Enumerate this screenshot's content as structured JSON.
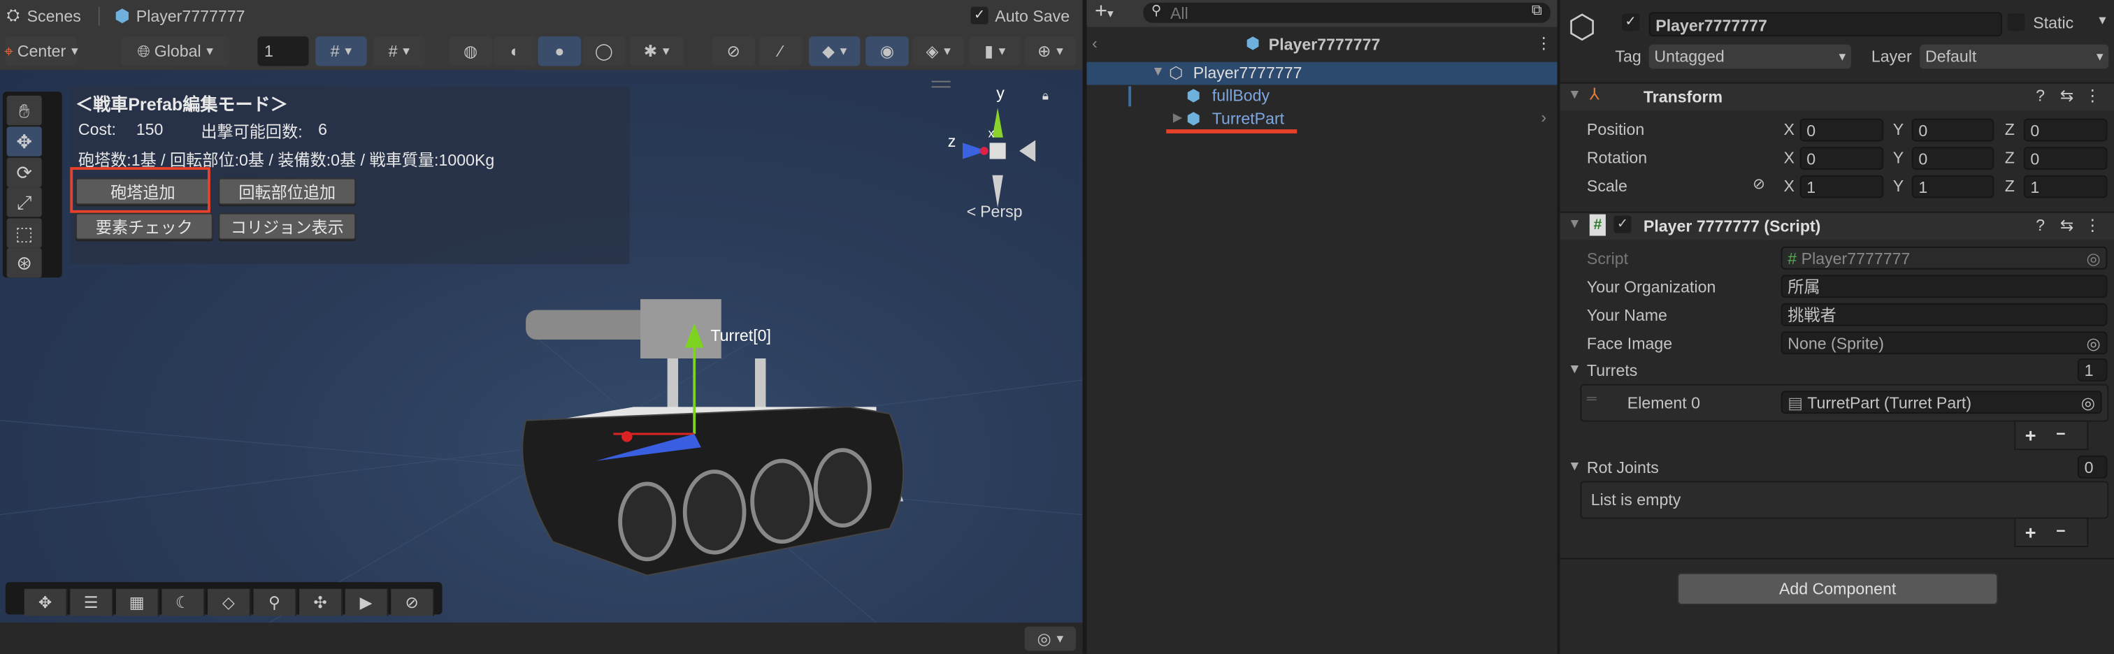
{
  "scene": {
    "breadcrumb": {
      "root": "Scenes",
      "prefab": "Player7777777"
    },
    "auto_save_label": "Auto Save",
    "auto_save_checked": true,
    "toolbar": {
      "pivot": "Center",
      "space": "Global",
      "grid_value": "1"
    },
    "overlay": {
      "title": "＜戦車Prefab編集モード＞",
      "cost_label": "Cost:",
      "cost_value": "150",
      "sortie_label": "出撃可能回数:",
      "sortie_value": "6",
      "stats": "砲塔数:1基 / 回転部位:0基 / 装備数:0基 / 戦車質量:1000Kg",
      "buttons": [
        "砲塔追加",
        "回転部位追加",
        "要素チェック",
        "コリジョン表示"
      ]
    },
    "gizmo": {
      "y": "y",
      "z": "z",
      "x": "x",
      "persp": "Persp"
    },
    "turret_label": "Turret[0]"
  },
  "hierarchy": {
    "search_placeholder": "All",
    "header_title": "Player7777777",
    "items": [
      {
        "label": "Player7777777",
        "depth": 0,
        "selected": true
      },
      {
        "label": "fullBody",
        "depth": 1
      },
      {
        "label": "TurretPart",
        "depth": 1
      }
    ]
  },
  "inspector": {
    "object_name": "Player7777777",
    "active": true,
    "static_label": "Static",
    "tag_label": "Tag",
    "tag_value": "Untagged",
    "layer_label": "Layer",
    "layer_value": "Default",
    "transform": {
      "title": "Transform",
      "rows": [
        {
          "label": "Position",
          "x": "0",
          "y": "0",
          "z": "0"
        },
        {
          "label": "Rotation",
          "x": "0",
          "y": "0",
          "z": "0"
        },
        {
          "label": "Scale",
          "x": "1",
          "y": "1",
          "z": "1"
        }
      ],
      "axes": [
        "X",
        "Y",
        "Z"
      ]
    },
    "script": {
      "title": "Player 7777777 (Script)",
      "script_label": "Script",
      "script_value": "Player7777777",
      "org_label": "Your Organization",
      "org_value": "所属",
      "name_label": "Your Name",
      "name_value": "挑戦者",
      "face_label": "Face Image",
      "face_value": "None (Sprite)",
      "turrets_label": "Turrets",
      "turrets_count": "1",
      "element_label": "Element 0",
      "element_value": "TurretPart (Turret Part)",
      "rotjoints_label": "Rot Joints",
      "rotjoints_count": "0",
      "empty_label": "List is empty",
      "plus": "+",
      "minus": "−"
    },
    "add_component": "Add Component"
  },
  "colors": {
    "accent_red": "#e8412a",
    "selection": "#2c4a6e",
    "viewport": "#2a3b58"
  }
}
